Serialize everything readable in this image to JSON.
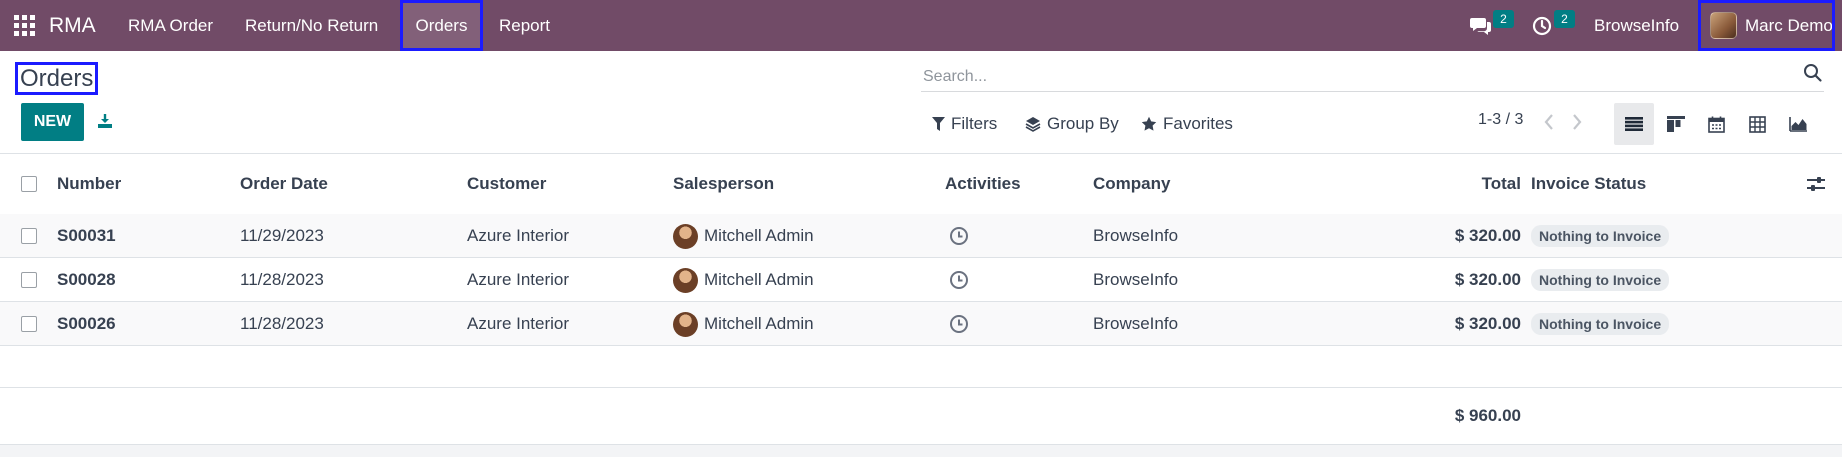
{
  "navbar": {
    "apps_icon": "grid-icon",
    "brand": "RMA",
    "menu": [
      "RMA Order",
      "Return/No Return",
      "Orders",
      "Report"
    ],
    "messages_count": "2",
    "activities_count": "2",
    "company": "BrowseInfo",
    "user": "Marc Demo",
    "color": "#714b67"
  },
  "control_panel": {
    "title": "Orders",
    "new_label": "NEW",
    "search_placeholder": "Search...",
    "filters_label": "Filters",
    "group_by_label": "Group By",
    "favorites_label": "Favorites",
    "pager": "1-3 / 3",
    "views": [
      "list-icon",
      "kanban-icon",
      "calendar-icon",
      "pivot-icon",
      "graph-icon"
    ],
    "accent_color": "#017e84"
  },
  "table": {
    "columns": {
      "number": "Number",
      "order_date": "Order Date",
      "customer": "Customer",
      "salesperson": "Salesperson",
      "activities": "Activities",
      "company": "Company",
      "total": "Total",
      "invoice_status": "Invoice Status"
    },
    "rows": [
      {
        "number": "S00031",
        "order_date": "11/29/2023",
        "customer": "Azure Interior",
        "salesperson": "Mitchell Admin",
        "company": "BrowseInfo",
        "total": "$ 320.00",
        "invoice_status": "Nothing to Invoice"
      },
      {
        "number": "S00028",
        "order_date": "11/28/2023",
        "customer": "Azure Interior",
        "salesperson": "Mitchell Admin",
        "company": "BrowseInfo",
        "total": "$ 320.00",
        "invoice_status": "Nothing to Invoice"
      },
      {
        "number": "S00026",
        "order_date": "11/28/2023",
        "customer": "Azure Interior",
        "salesperson": "Mitchell Admin",
        "company": "BrowseInfo",
        "total": "$ 320.00",
        "invoice_status": "Nothing to Invoice"
      }
    ],
    "grand_total": "$ 960.00"
  }
}
